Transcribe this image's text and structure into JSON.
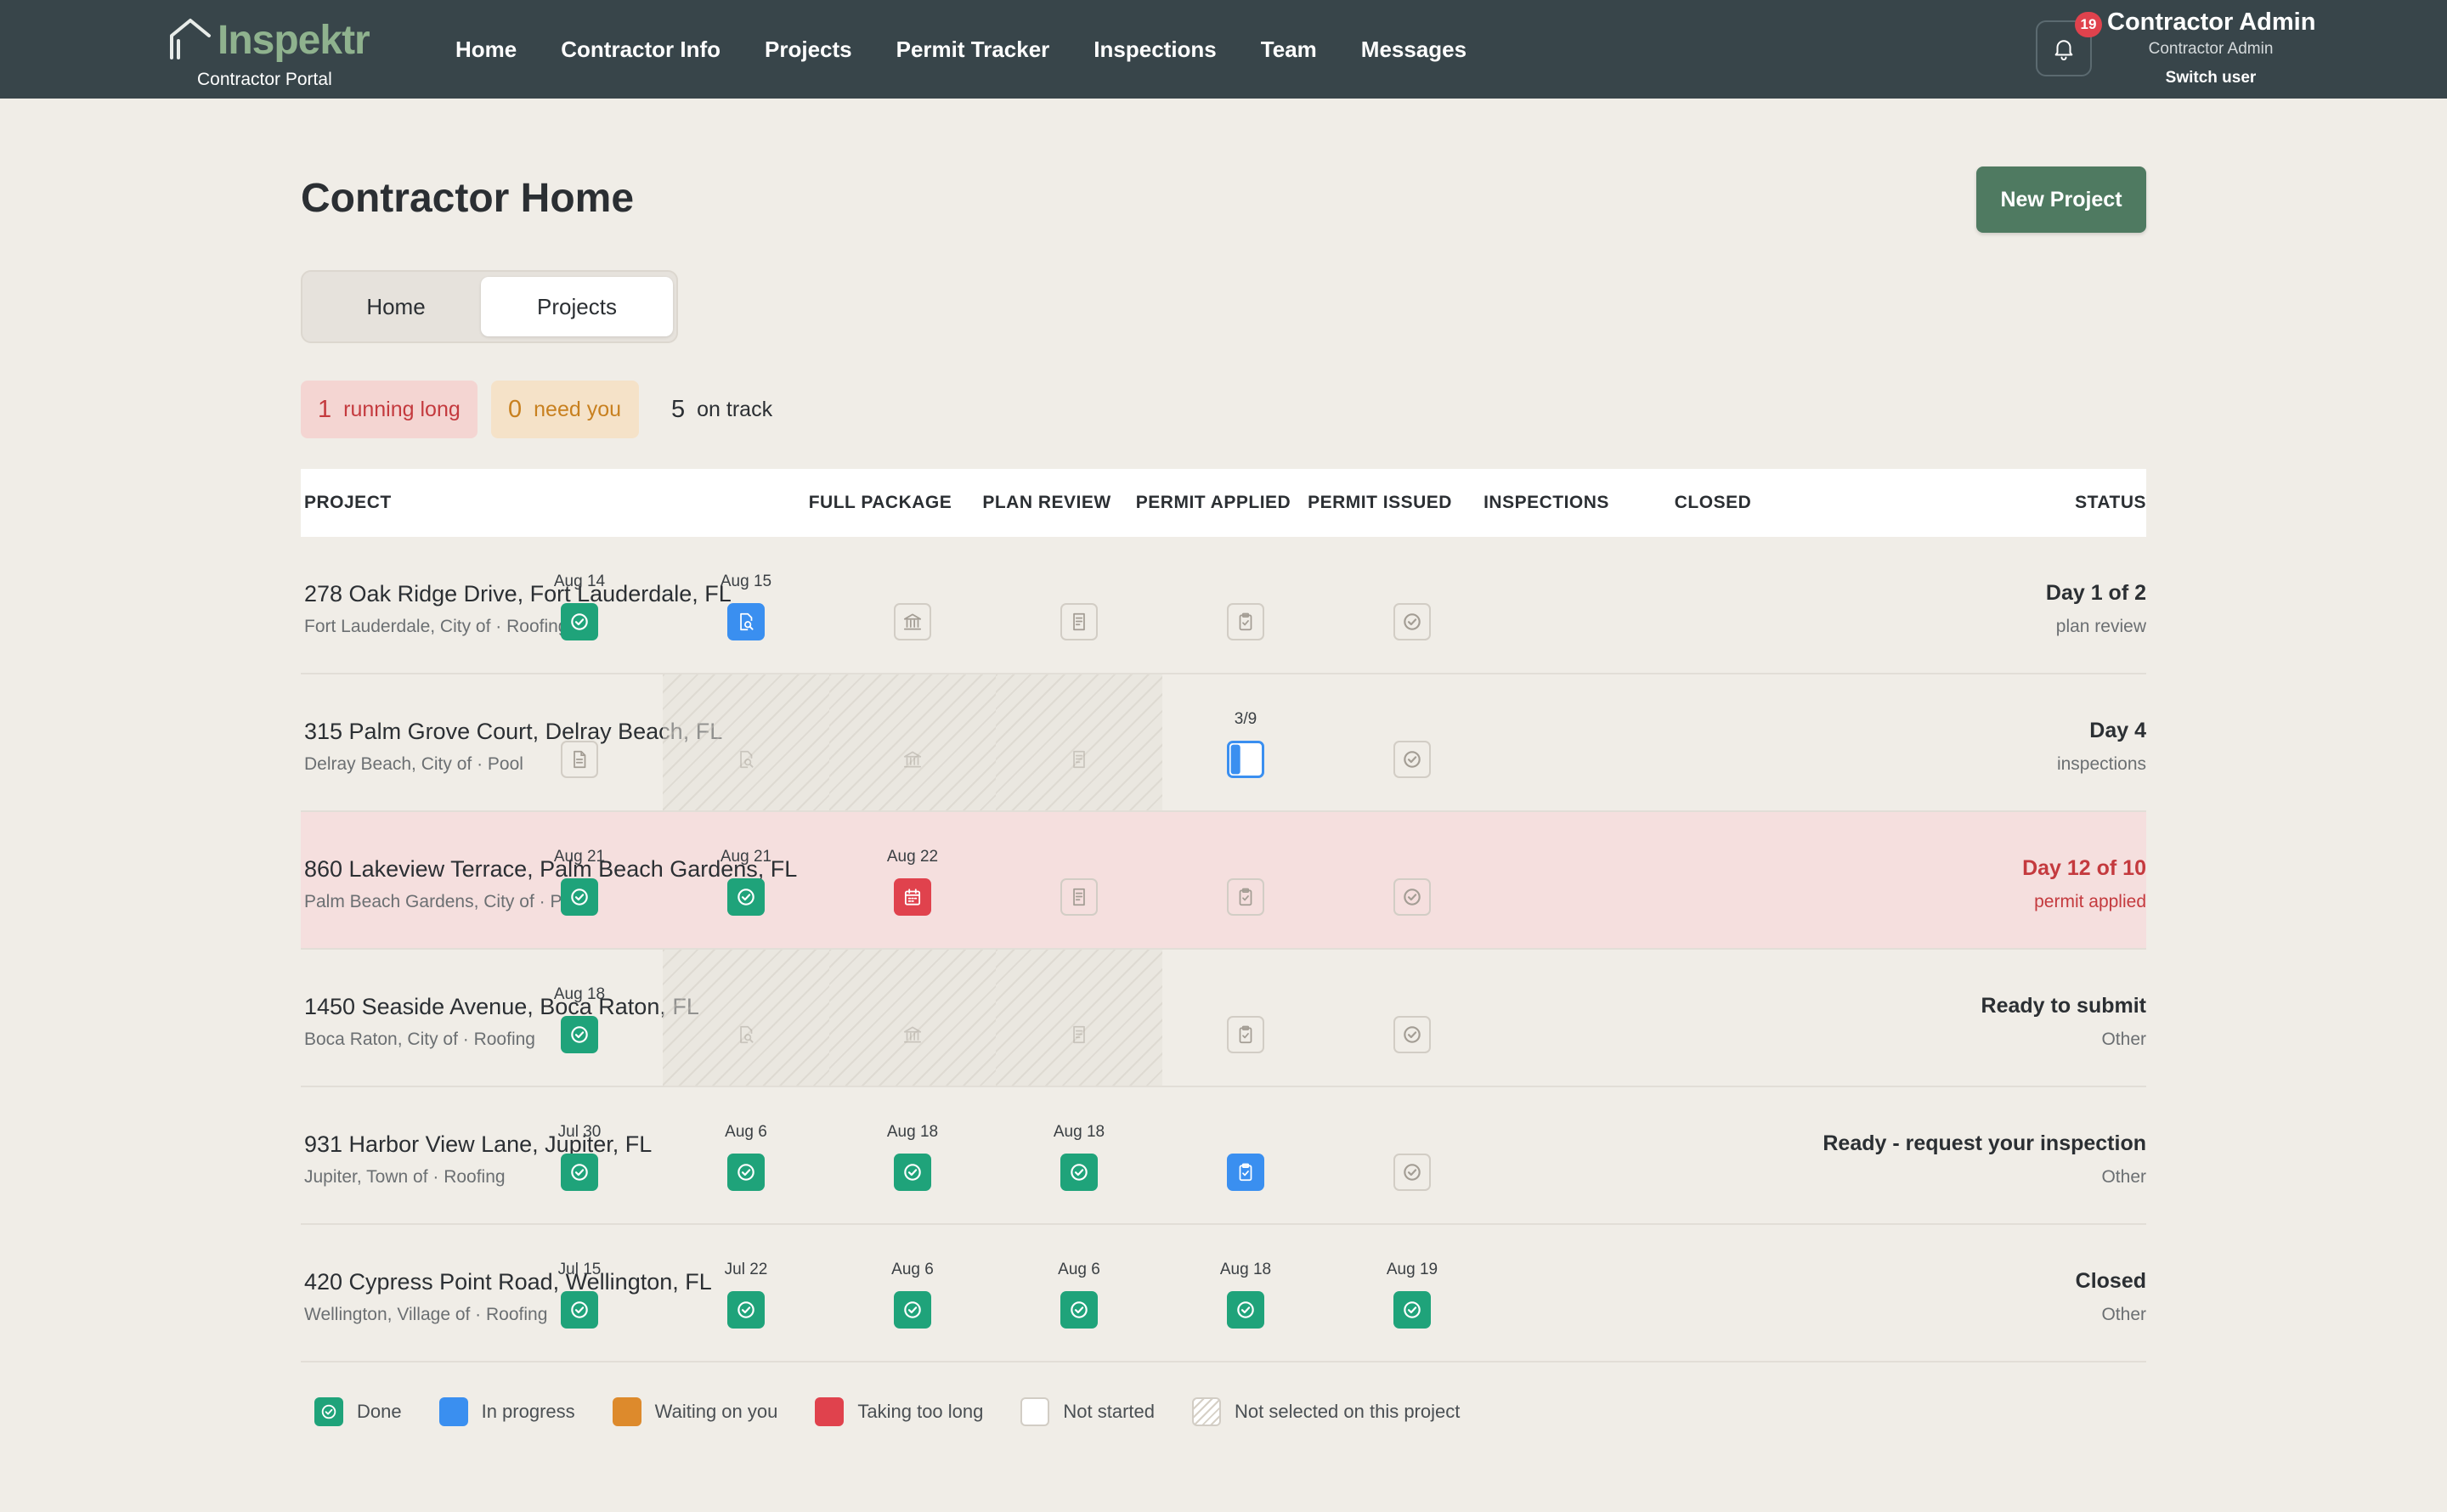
{
  "brand": {
    "name": "Inspektr",
    "subtitle": "Contractor Portal"
  },
  "nav": [
    {
      "label": "Home"
    },
    {
      "label": "Contractor Info"
    },
    {
      "label": "Projects"
    },
    {
      "label": "Permit Tracker"
    },
    {
      "label": "Inspections"
    },
    {
      "label": "Team"
    },
    {
      "label": "Messages"
    }
  ],
  "notifications": {
    "count": "19"
  },
  "user": {
    "name": "Contractor Admin",
    "role": "Contractor Admin",
    "switch_label": "Switch user"
  },
  "page": {
    "title": "Contractor Home",
    "new_project_label": "New Project"
  },
  "tabs": {
    "home": "Home",
    "projects": "Projects",
    "active": "Projects"
  },
  "summary": {
    "running_long": {
      "count": "1",
      "label": "running long"
    },
    "need_you": {
      "count": "0",
      "label": "need you"
    },
    "on_track": {
      "count": "5",
      "label": "on track"
    }
  },
  "table": {
    "headers": {
      "project": "PROJECT",
      "full_package": "FULL PACKAGE",
      "plan_review": "PLAN REVIEW",
      "permit_applied": "PERMIT APPLIED",
      "permit_issued": "PERMIT ISSUED",
      "inspections": "INSPECTIONS",
      "closed": "CLOSED",
      "status": "STATUS"
    },
    "stage_icons": [
      "document-icon",
      "magnify-doc-icon",
      "building-icon",
      "receipt-icon",
      "clipboard-icon",
      "check-circle-icon"
    ],
    "rows": [
      {
        "title": "278 Oak Ridge Drive, Fort Lauderdale, FL",
        "subtitle": "Fort Lauderdale, City of · Roofing",
        "status": "Day 1 of 2",
        "stage": "plan review",
        "alert": false,
        "stages": [
          {
            "date": "Aug 14",
            "state": "done"
          },
          {
            "date": "Aug 15",
            "state": "progress"
          },
          {
            "date": "",
            "state": "none"
          },
          {
            "date": "",
            "state": "none"
          },
          {
            "date": "",
            "state": "none"
          },
          {
            "date": "",
            "state": "none"
          }
        ]
      },
      {
        "title": "315 Palm Grove Court, Delray Beach, FL",
        "subtitle": "Delray Beach, City of · Pool",
        "status": "Day 4",
        "stage": "inspections",
        "alert": false,
        "stages": [
          {
            "date": "",
            "state": "none"
          },
          {
            "date": "",
            "state": "na"
          },
          {
            "date": "",
            "state": "na"
          },
          {
            "date": "",
            "state": "na"
          },
          {
            "date": "3/9",
            "state": "progress-partial"
          },
          {
            "date": "",
            "state": "none"
          }
        ]
      },
      {
        "title": "860 Lakeview Terrace, Palm Beach Gardens, FL",
        "subtitle": "Palm Beach Gardens, City of · Pool",
        "status": "Day 12 of 10",
        "stage": "permit applied",
        "alert": true,
        "stages": [
          {
            "date": "Aug 21",
            "state": "done"
          },
          {
            "date": "Aug 21",
            "state": "done"
          },
          {
            "date": "Aug 22",
            "state": "late"
          },
          {
            "date": "",
            "state": "none"
          },
          {
            "date": "",
            "state": "none"
          },
          {
            "date": "",
            "state": "none"
          }
        ]
      },
      {
        "title": "1450 Seaside Avenue, Boca Raton, FL",
        "subtitle": "Boca Raton, City of · Roofing",
        "status": "Ready to submit",
        "stage": "Other",
        "alert": false,
        "stages": [
          {
            "date": "Aug 18",
            "state": "done"
          },
          {
            "date": "",
            "state": "na"
          },
          {
            "date": "",
            "state": "na"
          },
          {
            "date": "",
            "state": "na"
          },
          {
            "date": "",
            "state": "none"
          },
          {
            "date": "",
            "state": "none"
          }
        ]
      },
      {
        "title": "931 Harbor View Lane, Jupiter, FL",
        "subtitle": "Jupiter, Town of · Roofing",
        "status": "Ready - request your inspection",
        "stage": "Other",
        "alert": false,
        "stages": [
          {
            "date": "Jul 30",
            "state": "done"
          },
          {
            "date": "Aug 6",
            "state": "done"
          },
          {
            "date": "Aug 18",
            "state": "done"
          },
          {
            "date": "Aug 18",
            "state": "done"
          },
          {
            "date": "",
            "state": "progress"
          },
          {
            "date": "",
            "state": "none"
          }
        ]
      },
      {
        "title": "420 Cypress Point Road, Wellington, FL",
        "subtitle": "Wellington, Village of · Roofing",
        "status": "Closed",
        "stage": "Other",
        "alert": false,
        "stages": [
          {
            "date": "Jul 15",
            "state": "done"
          },
          {
            "date": "Jul 22",
            "state": "done"
          },
          {
            "date": "Aug 6",
            "state": "done"
          },
          {
            "date": "Aug 6",
            "state": "done"
          },
          {
            "date": "Aug 18",
            "state": "done"
          },
          {
            "date": "Aug 19",
            "state": "done"
          }
        ]
      }
    ]
  },
  "legend": [
    {
      "label": "Done",
      "state": "done"
    },
    {
      "label": "In progress",
      "state": "progress"
    },
    {
      "label": "Waiting on you",
      "state": "wait"
    },
    {
      "label": "Taking too long",
      "state": "late"
    },
    {
      "label": "Not started",
      "state": "none"
    },
    {
      "label": "Not selected on this project",
      "state": "na"
    }
  ],
  "colors": {
    "topbar": "#38454a",
    "accent_green": "#4f7a61",
    "done": "#1fa37a",
    "in_progress": "#3a8ff0",
    "waiting": "#dd8a2c",
    "late": "#e0424d",
    "alert_row": "#f5dfde"
  }
}
